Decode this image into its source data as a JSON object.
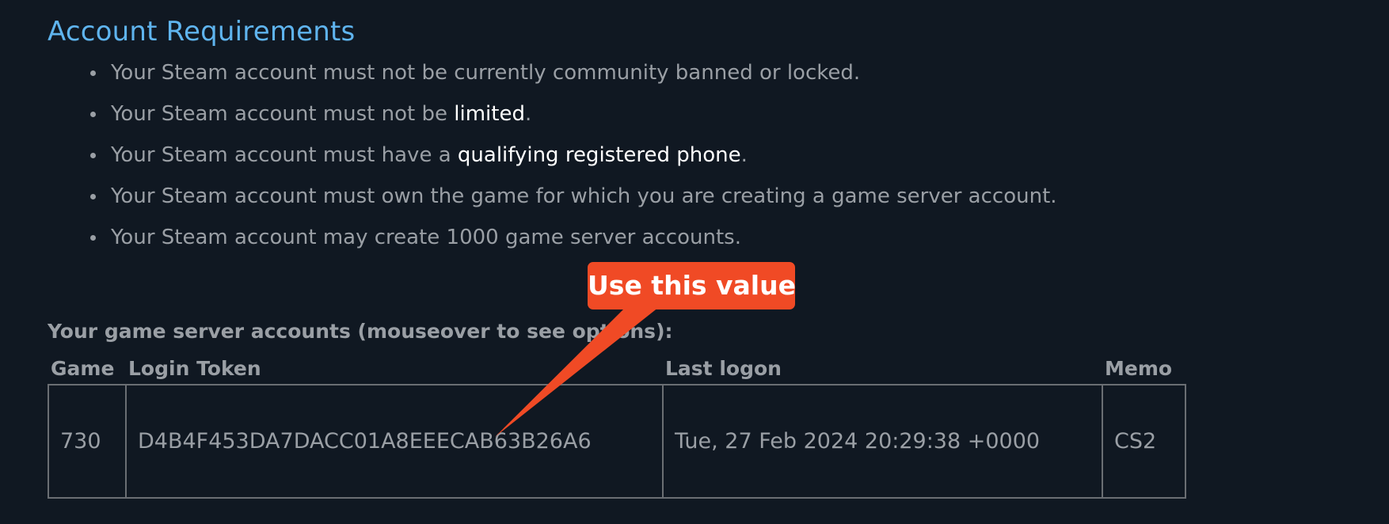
{
  "section_title": "Account Requirements",
  "requirements": [
    {
      "pre": "Your Steam account must not be currently community banned or locked.",
      "link": "",
      "post": ""
    },
    {
      "pre": "Your Steam account must not be ",
      "link": "limited",
      "post": "."
    },
    {
      "pre": "Your Steam account must have a ",
      "link": "qualifying registered phone",
      "post": "."
    },
    {
      "pre": "Your Steam account must own the game for which you are creating a game server account.",
      "link": "",
      "post": ""
    },
    {
      "pre": "Your Steam account may create 1000 game server accounts.",
      "link": "",
      "post": ""
    }
  ],
  "accounts": {
    "heading": "Your game server accounts (mouseover to see options):",
    "columns": [
      "Game",
      "Login Token",
      "Last logon",
      "Memo"
    ],
    "rows": [
      {
        "game": "730",
        "token": "D4B4F453DA7DACC01A8EEECAB63B26A6",
        "last_logon": "Tue, 27 Feb 2024 20:29:38 +0000",
        "memo": "CS2"
      }
    ]
  },
  "callout": {
    "text": "Use this value",
    "color": "#f04a25"
  },
  "colors": {
    "background": "#101822",
    "title": "#5fb4ee",
    "text": "#9a9fa5",
    "link": "#ffffff",
    "table_border": "#6a6e73"
  }
}
